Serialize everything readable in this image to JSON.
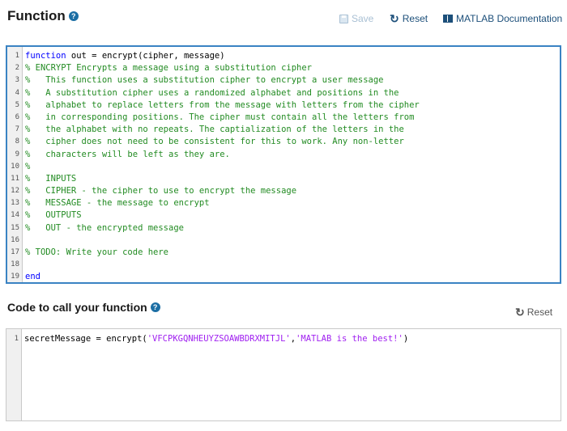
{
  "header": {
    "title": "Function",
    "save_label": "Save",
    "reset_label": "Reset",
    "doc_label": "MATLAB Documentation"
  },
  "function_editor": {
    "lines": [
      {
        "n": "1",
        "parts": [
          {
            "t": "kw",
            "s": "function"
          },
          {
            "t": "tx",
            "s": " out = encrypt(cipher, message)"
          }
        ]
      },
      {
        "n": "2",
        "parts": [
          {
            "t": "cm",
            "s": "% ENCRYPT Encrypts a message using a substitution cipher"
          }
        ]
      },
      {
        "n": "3",
        "parts": [
          {
            "t": "cm",
            "s": "%   This function uses a substitution cipher to encrypt a user message"
          }
        ]
      },
      {
        "n": "4",
        "parts": [
          {
            "t": "cm",
            "s": "%   A substitution cipher uses a randomized alphabet and positions in the"
          }
        ]
      },
      {
        "n": "5",
        "parts": [
          {
            "t": "cm",
            "s": "%   alphabet to replace letters from the message with letters from the cipher"
          }
        ]
      },
      {
        "n": "6",
        "parts": [
          {
            "t": "cm",
            "s": "%   in corresponding positions. The cipher must contain all the letters from"
          }
        ]
      },
      {
        "n": "7",
        "parts": [
          {
            "t": "cm",
            "s": "%   the alphabet with no repeats. The captialization of the letters in the"
          }
        ]
      },
      {
        "n": "8",
        "parts": [
          {
            "t": "cm",
            "s": "%   cipher does not need to be consistent for this to work. Any non-letter"
          }
        ]
      },
      {
        "n": "9",
        "parts": [
          {
            "t": "cm",
            "s": "%   characters will be left as they are."
          }
        ]
      },
      {
        "n": "10",
        "parts": [
          {
            "t": "cm",
            "s": "%"
          }
        ]
      },
      {
        "n": "11",
        "parts": [
          {
            "t": "cm",
            "s": "%   INPUTS"
          }
        ]
      },
      {
        "n": "12",
        "parts": [
          {
            "t": "cm",
            "s": "%   CIPHER - the cipher to use to encrypt the message"
          }
        ]
      },
      {
        "n": "13",
        "parts": [
          {
            "t": "cm",
            "s": "%   MESSAGE - the message to encrypt"
          }
        ]
      },
      {
        "n": "14",
        "parts": [
          {
            "t": "cm",
            "s": "%   OUTPUTS"
          }
        ]
      },
      {
        "n": "15",
        "parts": [
          {
            "t": "cm",
            "s": "%   OUT - the encrypted message"
          }
        ]
      },
      {
        "n": "16",
        "parts": []
      },
      {
        "n": "17",
        "parts": [
          {
            "t": "cm",
            "s": "% TODO: Write your code here"
          }
        ]
      },
      {
        "n": "18",
        "parts": []
      },
      {
        "n": "19",
        "parts": [
          {
            "t": "kw",
            "s": "end"
          }
        ]
      }
    ]
  },
  "call_section": {
    "title": "Code to call your function",
    "reset_label": "Reset"
  },
  "call_editor": {
    "lines": [
      {
        "n": "1",
        "parts": [
          {
            "t": "tx",
            "s": "secretMessage = encrypt("
          },
          {
            "t": "str",
            "s": "'VFCPKGQNHEUYZSOAWBDRXMITJL'"
          },
          {
            "t": "tx",
            "s": ","
          },
          {
            "t": "str",
            "s": "'MATLAB is the best!'"
          },
          {
            "t": "tx",
            "s": ")"
          }
        ]
      }
    ]
  },
  "colors": {
    "accent": "#3a83c3",
    "keyword": "#0000ff",
    "comment": "#228b22",
    "string": "#a020f0"
  },
  "icons": {
    "help": "question-circle-icon",
    "save": "floppy-disk-icon",
    "reset": "circular-arrow-icon",
    "documentation": "book-icon"
  }
}
